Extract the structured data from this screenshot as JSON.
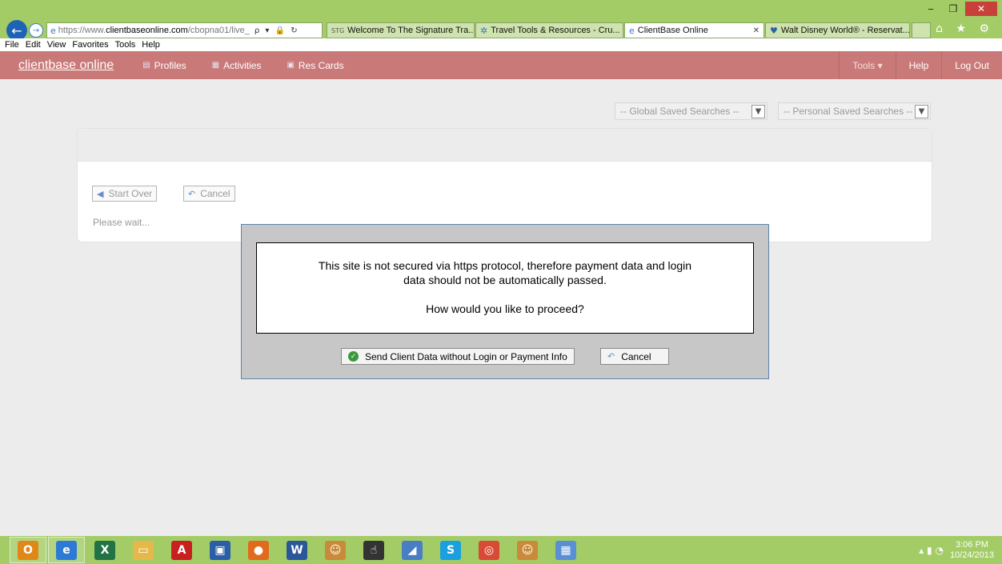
{
  "browser": {
    "window_controls": {
      "minimize": "‒",
      "restore": "❐",
      "close": "✕"
    },
    "address": {
      "url_prefix": "https://www.",
      "url_domain": "clientbaseonline.com",
      "url_path": "/cbopna01/live_",
      "tools": "ρ ▾ 🔒 ↻"
    },
    "tabs": [
      {
        "label": "Welcome To The Signature Tra...",
        "icon": "STG",
        "active": false
      },
      {
        "label": "Travel Tools & Resources - Cru...",
        "icon": "✲",
        "active": false
      },
      {
        "label": "ClientBase Online",
        "icon": "e",
        "active": true,
        "close": "✕"
      },
      {
        "label": "Walt Disney World® - Reservat...",
        "icon": "♥",
        "active": false
      }
    ],
    "right_icons": "⌂ ★ ⚙",
    "menu": [
      "File",
      "Edit",
      "View",
      "Favorites",
      "Tools",
      "Help"
    ]
  },
  "app": {
    "brand": "clientbase online",
    "nav": [
      {
        "label": "Profiles",
        "icon": "▤"
      },
      {
        "label": "Activities",
        "icon": "▦"
      },
      {
        "label": "Res Cards",
        "icon": "▣"
      }
    ],
    "nav_right": [
      "Tools ▾",
      "Help",
      "Log Out"
    ],
    "global_search": "-- Global Saved Searches --",
    "personal_search": "-- Personal Saved Searches --",
    "buttons": {
      "start_over": "Start Over",
      "cancel": "Cancel"
    },
    "wait_text": "Please wait..."
  },
  "modal": {
    "line1": "This site is not secured via https protocol, therefore payment data and login",
    "line2": "data should not be automatically passed.",
    "question": "How would you like to proceed?",
    "send_button": "Send Client Data without Login or Payment Info",
    "cancel_button": "Cancel"
  },
  "taskbar": {
    "apps": [
      {
        "name": "outlook",
        "glyph": "O",
        "color": "#e0871a"
      },
      {
        "name": "internet-explorer",
        "glyph": "e",
        "color": "#2d7ad6"
      },
      {
        "name": "excel",
        "glyph": "X",
        "color": "#217346"
      },
      {
        "name": "file-explorer",
        "glyph": "▭",
        "color": "#e6b84a"
      },
      {
        "name": "acrobat",
        "glyph": "A",
        "color": "#c8201e"
      },
      {
        "name": "remote-desktop",
        "glyph": "▣",
        "color": "#2a5fa8"
      },
      {
        "name": "firefox",
        "glyph": "●",
        "color": "#e16a1c"
      },
      {
        "name": "word",
        "glyph": "W",
        "color": "#2b579a"
      },
      {
        "name": "messenger",
        "glyph": "☺",
        "color": "#c98a3a"
      },
      {
        "name": "touch-app",
        "glyph": "☝",
        "color": "#333333"
      },
      {
        "name": "notepad-app",
        "glyph": "◢",
        "color": "#4a7ec4"
      },
      {
        "name": "skype",
        "glyph": "S",
        "color": "#1aa0de"
      },
      {
        "name": "chrome",
        "glyph": "◎",
        "color": "#d84a35"
      },
      {
        "name": "messenger-2",
        "glyph": "☺",
        "color": "#c98a3a"
      },
      {
        "name": "control-panel",
        "glyph": "▦",
        "color": "#5a8fd6"
      }
    ],
    "tray_icons": "▴ ▮ ◔",
    "time": "3:06 PM",
    "date": "10/24/2013"
  }
}
